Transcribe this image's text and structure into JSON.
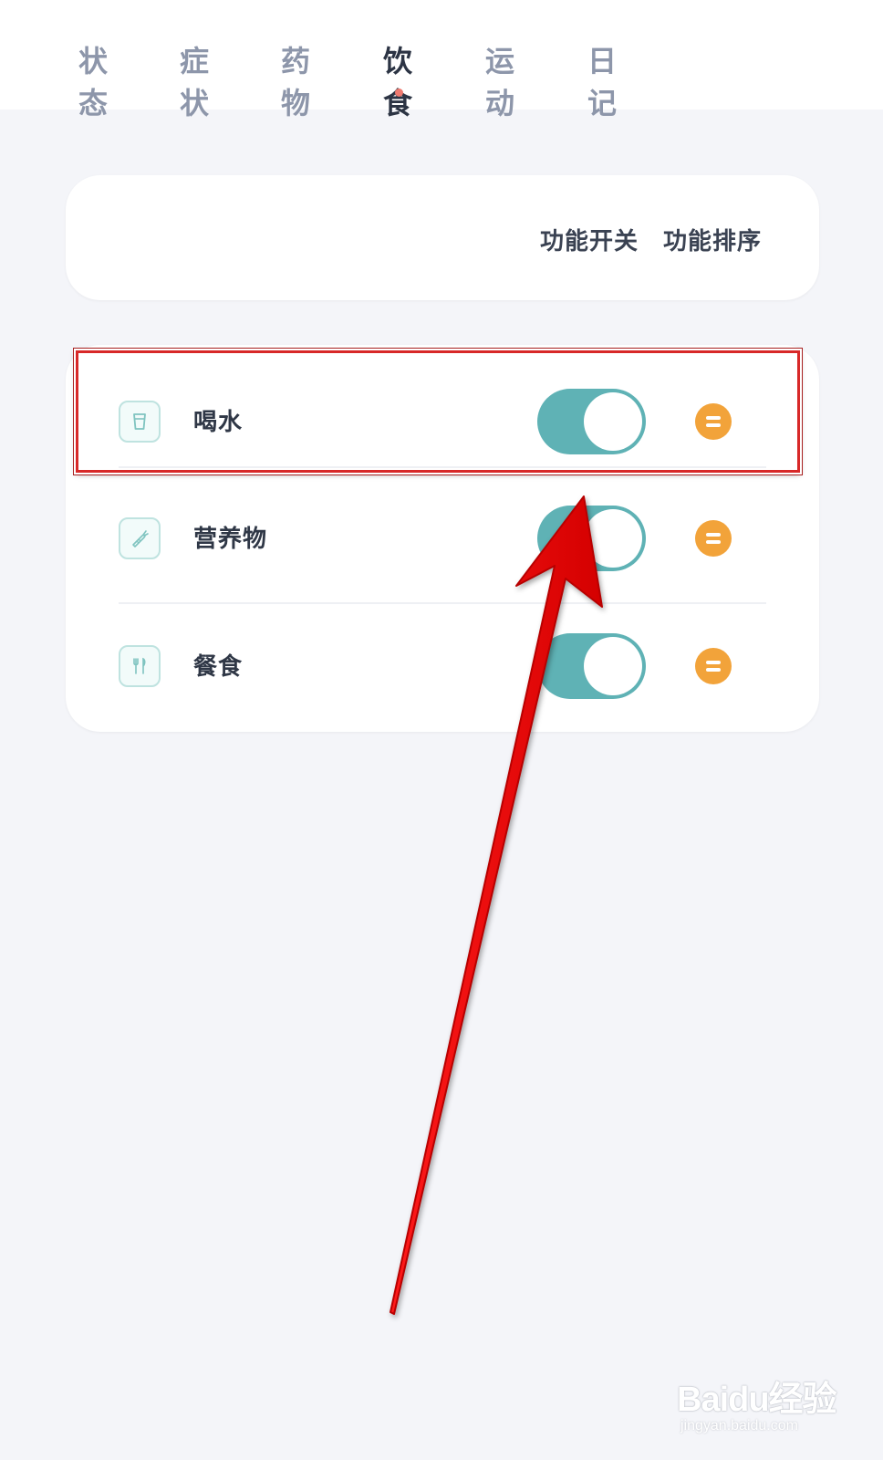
{
  "tabs": [
    {
      "label": "状态",
      "active": false
    },
    {
      "label": "症状",
      "active": false
    },
    {
      "label": "药物",
      "active": false
    },
    {
      "label": "饮食",
      "active": true
    },
    {
      "label": "运动",
      "active": false
    },
    {
      "label": "日记",
      "active": false
    }
  ],
  "header": {
    "toggle_label": "功能开关",
    "sort_label": "功能排序"
  },
  "items": [
    {
      "label": "喝水",
      "icon": "cup-icon",
      "enabled": true
    },
    {
      "label": "营养物",
      "icon": "carrot-icon",
      "enabled": true
    },
    {
      "label": "餐食",
      "icon": "fork-knife-icon",
      "enabled": true
    }
  ],
  "colors": {
    "toggle_on": "#5fb2b5",
    "drag_handle": "#f2a33a",
    "active_dot": "#ef7a70",
    "annotation_red": "#d82828"
  },
  "watermark": {
    "brand": "Baidu经验",
    "url": "jingyan.baidu.com"
  }
}
